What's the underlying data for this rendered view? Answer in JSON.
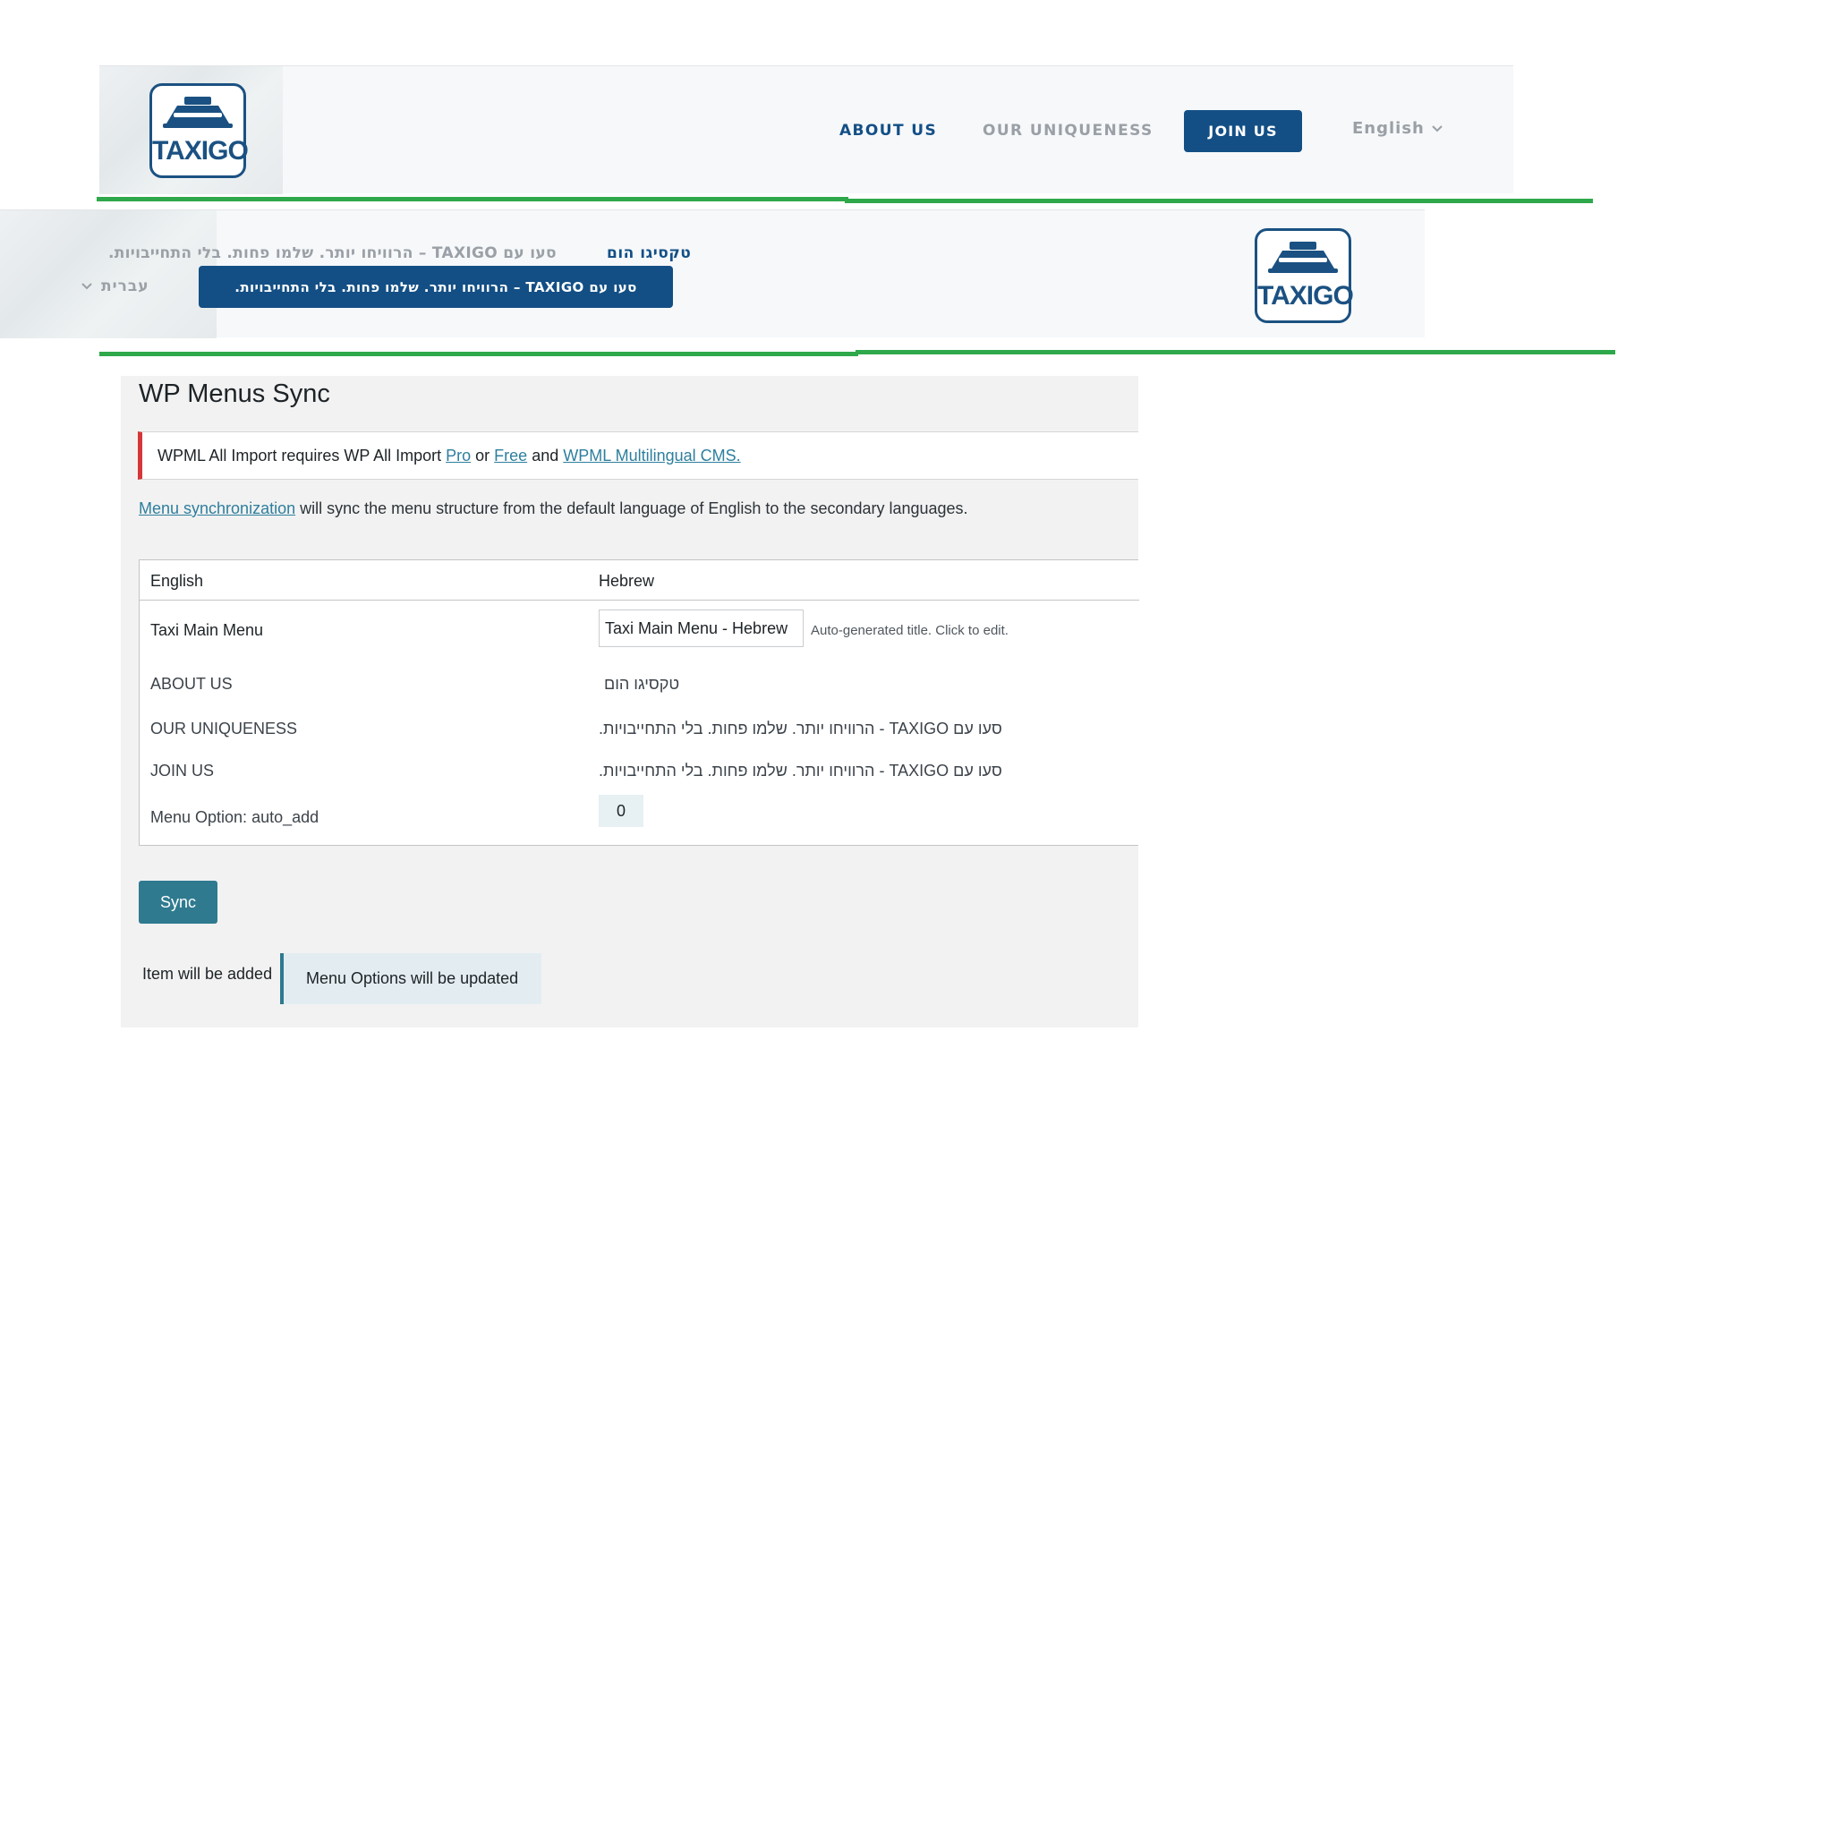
{
  "colors": {
    "brand_blue": "#134f85",
    "accent_green": "#2ea84a",
    "wp_teal": "#2f7a8f",
    "notice_red": "#d63638"
  },
  "header_en": {
    "logo_text": "TAXIGO",
    "logo_icon": "taxi-sign-icon",
    "nav": [
      {
        "label": "ABOUT US",
        "state": "active"
      },
      {
        "label": "OUR UNIQUENESS",
        "state": "muted"
      }
    ],
    "cta_label": "JOIN US",
    "language_label": "English"
  },
  "header_he": {
    "logo_text": "TAXIGO",
    "nav_item_1": "טקסיגו הום",
    "nav_item_2": "סעו עם TAXIGO – הרוויחו יותר. שלמו פחות. בלי התחייבויות.",
    "cta_label": "סעו עם TAXIGO – הרוויחו יותר. שלמו פחות. בלי התחייבויות.",
    "language_label": "עברית"
  },
  "wp": {
    "title": "WP Menus Sync",
    "notice": {
      "prefix": "WPML All Import requires WP All Import",
      "link_pro": "Pro",
      "or": "or",
      "link_free": "Free",
      "and": "and",
      "link_wpml": "WPML Multilingual CMS."
    },
    "description": {
      "link": "Menu synchronization",
      "text": "will sync the menu structure from the default language of English to the secondary languages."
    },
    "table": {
      "col_en": "English",
      "col_he": "Hebrew",
      "menu_name_en": "Taxi Main Menu",
      "menu_name_he": "Taxi Main Menu - Hebrew",
      "menu_name_hint": "Auto-generated title. Click to edit.",
      "rows": [
        {
          "en": "ABOUT US",
          "he": "טקסיגו הום"
        },
        {
          "en": "OUR UNIQUENESS",
          "he": "סעו עם TAXIGO - הרוויחו יותר. שלמו פחות. בלי התחייבויות."
        },
        {
          "en": "JOIN US",
          "he": "סעו עם TAXIGO - הרוויחו יותר. שלמו פחות. בלי התחייבויות."
        }
      ],
      "option_label": "Menu Option: auto_add",
      "option_value": "0"
    },
    "sync_button": "Sync",
    "legend": {
      "added": "Item will be added",
      "updated": "Menu Options will be updated"
    }
  }
}
